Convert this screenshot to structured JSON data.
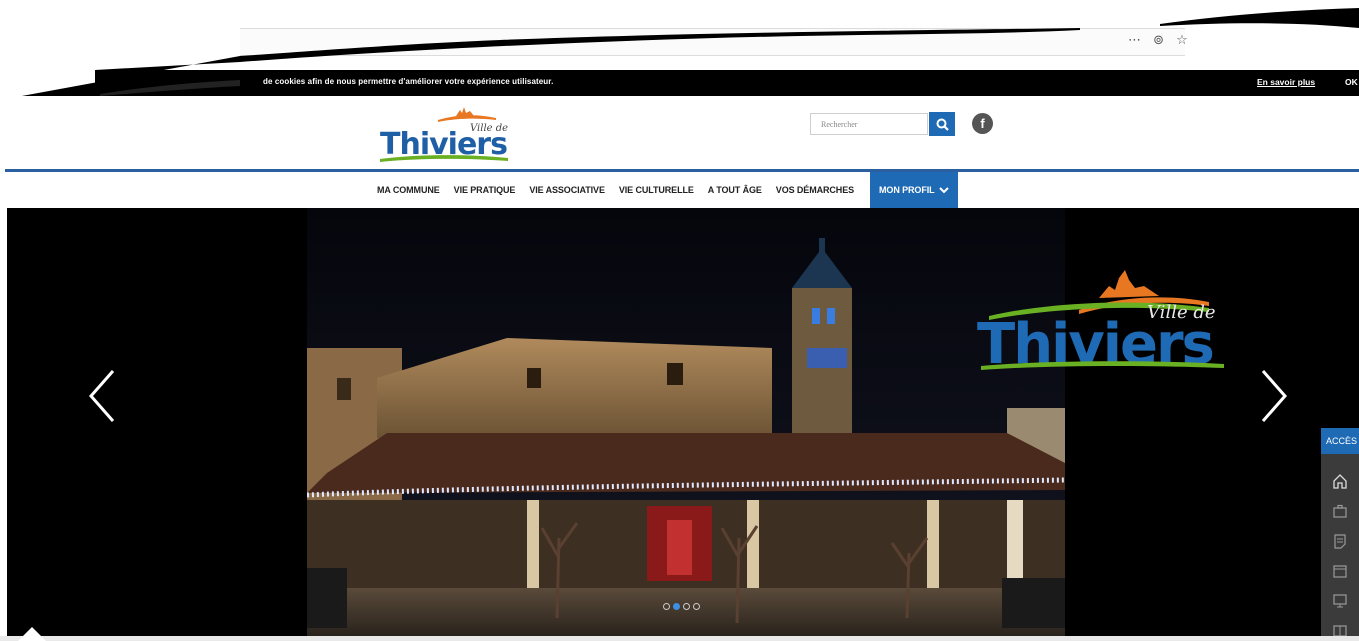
{
  "browser": {
    "icons": [
      "more-icon",
      "pocket-icon",
      "bookmark-star-icon"
    ],
    "icon_glyphs": "⋯ ⊚ ☆"
  },
  "cookie_banner": {
    "text": "de cookies afin de nous permettre d'améliorer votre expérience utilisateur.",
    "learn_more": "En savoir plus",
    "ok": "OK"
  },
  "header": {
    "logo_subtitle": "Ville de",
    "logo_title": "Thiviers",
    "search_placeholder": "Rechercher",
    "search_icon": "search-icon",
    "facebook_icon": "facebook-icon",
    "facebook_glyph": "f"
  },
  "nav": {
    "items": [
      "MA COMMUNE",
      "VIE PRATIQUE",
      "VIE ASSOCIATIVE",
      "VIE CULTURELLE",
      "A TOUT ÂGE",
      "VOS DÉMARCHES"
    ],
    "profile": "MON PROFIL"
  },
  "hero": {
    "logo_subtitle": "Ville de",
    "logo_title": "Thiviers",
    "slide_count": 4,
    "active_slide": 2
  },
  "quick_access": {
    "label": "ACCÈS",
    "icons": [
      "home-icon",
      "briefcase-icon",
      "document-icon",
      "calendar-icon",
      "monitor-icon",
      "book-icon"
    ]
  },
  "colors": {
    "brand_blue": "#1f6ab5",
    "brand_orange": "#e87722",
    "brand_green": "#6ab023"
  }
}
